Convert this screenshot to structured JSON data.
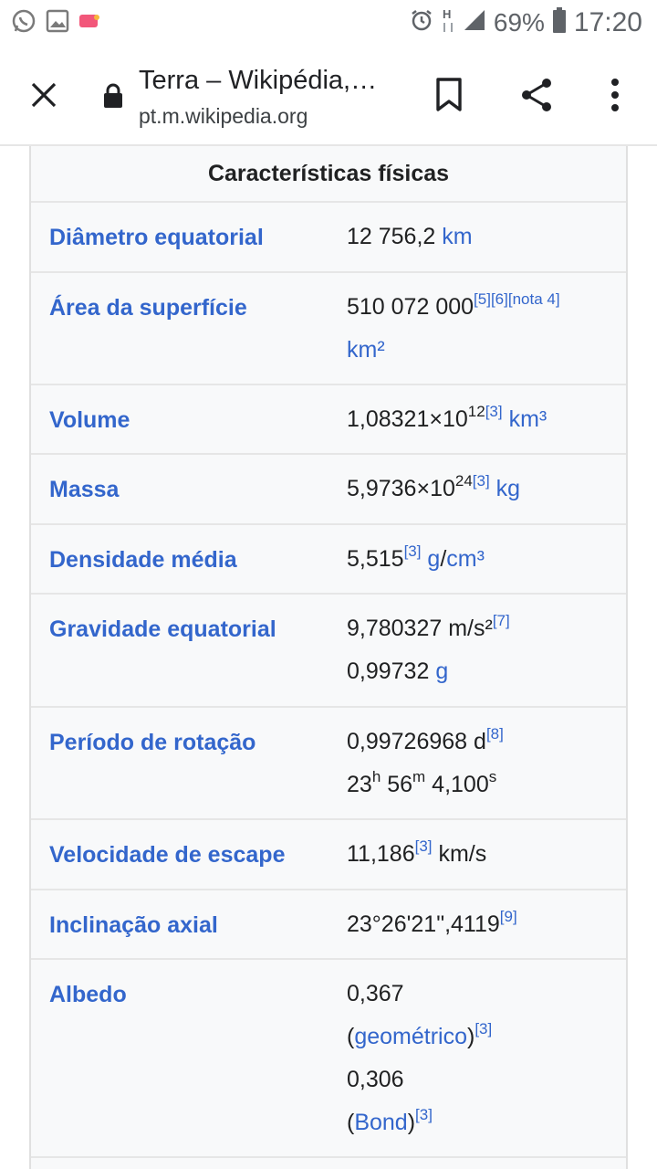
{
  "status_bar": {
    "battery_percent": "69%",
    "time": "17:20",
    "icons": [
      "whatsapp-icon",
      "gallery-icon",
      "notification-app-icon",
      "alarm-icon",
      "data-h-icon",
      "signal-icon",
      "battery-icon"
    ]
  },
  "toolbar": {
    "title": "Terra – Wikipédia,…",
    "url": "pt.m.wikipedia.org",
    "icons": [
      "close-icon",
      "lock-icon",
      "bookmark-icon",
      "share-icon",
      "more-vert-icon"
    ]
  },
  "infobox": {
    "header": "Características físicas",
    "rows": {
      "diametro": {
        "label": "Diâmetro equatorial",
        "value": "12 756,2",
        "unit": "km"
      },
      "area": {
        "label": "Área da superfície",
        "value": "510 072 000",
        "ref1": "[5]",
        "ref2": "[6]",
        "ref3": "[nota 4]",
        "unit": "km²"
      },
      "volume": {
        "label": "Volume",
        "mantissa": "1,08321×10",
        "exponent": "12",
        "ref": "[3]",
        "unit": "km³"
      },
      "massa": {
        "label": "Massa",
        "mantissa": "5,9736×10",
        "exponent": "24",
        "ref": "[3]",
        "unit": "kg"
      },
      "densidade": {
        "label": "Densidade média",
        "value": "5,515",
        "ref": "[3]",
        "unit_g": "g",
        "slash": "/",
        "unit_cm": "cm³"
      },
      "gravidade": {
        "label": "Gravidade equatorial",
        "value1": "9,780327 m/s²",
        "ref": "[7]",
        "value2": "0,99732",
        "unit_g": "g"
      },
      "rotacao": {
        "label": "Período de rotação",
        "value1": "0,99726968 d",
        "ref": "[8]",
        "hours": "23",
        "h_sup": "h",
        "minutes": "56",
        "m_sup": "m",
        "seconds": "4,100",
        "s_sup": "s"
      },
      "escape": {
        "label": "Velocidade de escape",
        "value": "11,186",
        "ref": "[3]",
        "unit": "km/s"
      },
      "inclinacao": {
        "label": "Inclinação axial",
        "value": "23°26'21\",4119",
        "ref": "[9]"
      },
      "albedo": {
        "label": "Albedo",
        "value1": "0,367",
        "open_paren": "(",
        "link1": "geométrico",
        "close_paren": ")",
        "ref1": "[3]",
        "value2": "0,306",
        "link2": "Bond",
        "ref2": "[3]"
      }
    }
  }
}
